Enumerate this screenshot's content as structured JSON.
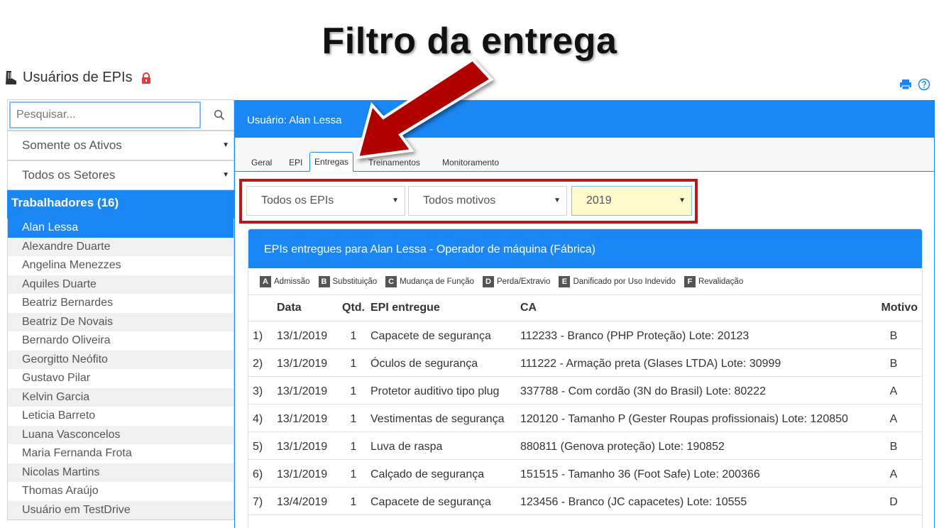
{
  "headline": "Filtro da entrega",
  "app": {
    "title": "Usuários de EPIs"
  },
  "search": {
    "placeholder": "Pesquisar..."
  },
  "sidebar": {
    "status_filter": "Somente os Ativos",
    "sector_filter": "Todos os Setores",
    "group_title": "Trabalhadores (16)",
    "workers": [
      "Alan Lessa",
      "Alexandre Duarte",
      "Angelina Menezzes",
      "Aquiles Duarte",
      "Beatriz Bernardes",
      "Beatriz De Novais",
      "Bernardo Oliveira",
      "Georgitto Neófito",
      "Gustavo Pilar",
      "Kelvin Garcia",
      "Leticia Barreto",
      "Luana Vasconcelos",
      "Maria Fernanda Frota",
      "Nicolas Martins",
      "Thomas Araújo",
      "Usuário em TestDrive"
    ],
    "active_worker": "Alan Lessa"
  },
  "main": {
    "header": "Usuário: Alan Lessa",
    "tabs": [
      "Geral",
      "EPI",
      "Entregas",
      "Treinamentos",
      "Monitoramento"
    ],
    "active_tab": "Entregas",
    "filters": {
      "epi": "Todos os EPIs",
      "motivo": "Todos motivos",
      "year": "2019"
    },
    "card_title": "EPIs entregues para Alan Lessa - Operador de máquina (Fábrica)",
    "legend": [
      {
        "key": "A",
        "label": "Admissão"
      },
      {
        "key": "B",
        "label": "Substituição"
      },
      {
        "key": "C",
        "label": "Mudança de Função"
      },
      {
        "key": "D",
        "label": "Perda/Extravio"
      },
      {
        "key": "E",
        "label": "Danificado por Uso Indevido"
      },
      {
        "key": "F",
        "label": "Revalidação"
      }
    ],
    "columns": {
      "date": "Data",
      "qtd": "Qtd.",
      "epi": "EPI entregue",
      "ca": "CA",
      "motivo": "Motivo"
    },
    "rows": [
      {
        "idx": "1)",
        "date": "13/1/2019",
        "qtd": "1",
        "epi": "Capacete de segurança",
        "ca": "112233 - Branco (PHP Proteção) Lote: 20123",
        "motivo": "B"
      },
      {
        "idx": "2)",
        "date": "13/1/2019",
        "qtd": "1",
        "epi": "Óculos de segurança",
        "ca": "111222 - Armação preta (Glases LTDA) Lote: 30999",
        "motivo": "B"
      },
      {
        "idx": "3)",
        "date": "13/1/2019",
        "qtd": "1",
        "epi": "Protetor auditivo tipo plug",
        "ca": "337788 - Com cordão (3N do Brasil) Lote: 80222",
        "motivo": "A"
      },
      {
        "idx": "4)",
        "date": "13/1/2019",
        "qtd": "1",
        "epi": "Vestimentas de segurança",
        "ca": "120120 - Tamanho P (Gester Roupas profissionais) Lote: 120850",
        "motivo": "A"
      },
      {
        "idx": "5)",
        "date": "13/1/2019",
        "qtd": "1",
        "epi": "Luva de raspa",
        "ca": "880811 (Genova proteção) Lote: 190852",
        "motivo": "B"
      },
      {
        "idx": "6)",
        "date": "13/1/2019",
        "qtd": "1",
        "epi": "Calçado de segurança",
        "ca": "151515 - Tamanho 36 (Foot Safe) Lote: 200366",
        "motivo": "A"
      },
      {
        "idx": "7)",
        "date": "13/4/2019",
        "qtd": "1",
        "epi": "Capacete de segurança",
        "ca": "123456 - Branco (JC capacetes) Lote: 10555",
        "motivo": "D"
      }
    ]
  },
  "colors": {
    "primary": "#1b87f5",
    "highlight_border": "#b01c1c",
    "arrow": "#b00000",
    "year_bg": "#fffacd"
  }
}
